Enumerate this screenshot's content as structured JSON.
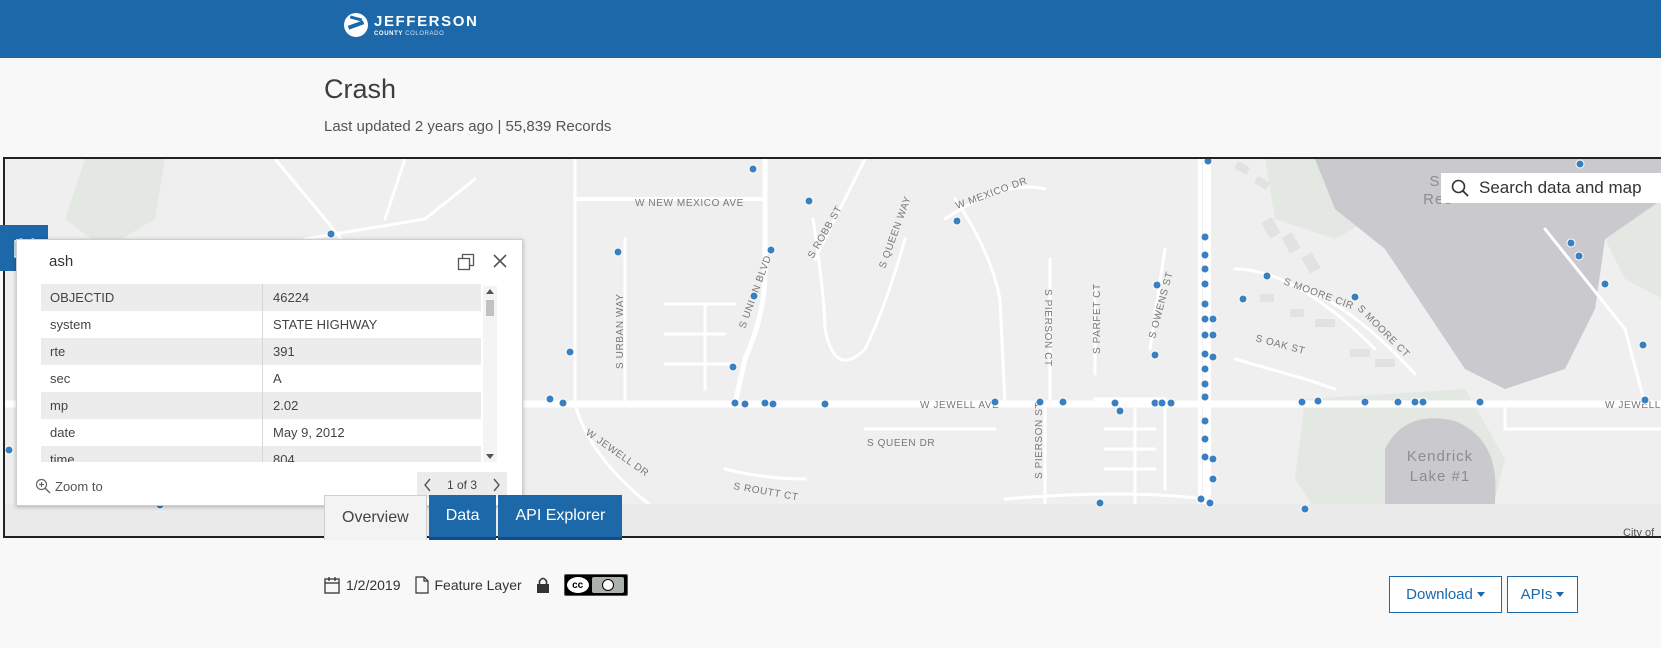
{
  "header": {
    "logo_title": "JEFFERSON",
    "logo_sub_county": "COUNTY",
    "logo_sub_state": "COLORADO"
  },
  "page": {
    "title": "Crash",
    "meta": "Last updated 2 years ago | 55,839 Records"
  },
  "map": {
    "search_placeholder": "Search data and map",
    "attribution": "City of",
    "streets": {
      "new_mexico_ave": "W NEW MEXICO AVE",
      "mexico_dr": "W MEXICO DR",
      "jewell_ave_1": "W JEWELL AVE",
      "jewell_ave_2": "W JEWELL",
      "jewell_dr": "W JEWELL DR",
      "queen_dr": "S QUEEN DR",
      "routt_ct": "S ROUTT CT",
      "urban_way": "S URBAN WAY",
      "union_blvd": "S UNION BLVD",
      "robb_st": "S ROBB ST",
      "queen_way": "S QUEEN WAY",
      "pierson_ct": "S PIERSON CT",
      "parfet_ct": "S PARFET CT",
      "owens_st": "S OWENS ST",
      "pierson_st": "S PIERSON ST",
      "moore_cir": "S MOORE CIR",
      "moore_ct": "S MOORE CT",
      "oak_st": "S OAK ST",
      "lake_label_1": "Kendrick",
      "lake_label_2": "Lake #1",
      "res_1": "S",
      "res_2": "Res"
    },
    "point_color": "#3a7fc1"
  },
  "popup": {
    "title": "ash",
    "rows": [
      {
        "key": "OBJECTID",
        "value": "46224"
      },
      {
        "key": "system",
        "value": "STATE HIGHWAY"
      },
      {
        "key": "rte",
        "value": "391"
      },
      {
        "key": "sec",
        "value": "A"
      },
      {
        "key": "mp",
        "value": "2.02"
      },
      {
        "key": "date",
        "value": "May 9, 2012"
      },
      {
        "key": "time",
        "value": "804"
      }
    ],
    "zoom_to": "Zoom to",
    "pager": "1 of 3"
  },
  "tabs": [
    {
      "label": "Overview"
    },
    {
      "label": "Data"
    },
    {
      "label": "API Explorer"
    }
  ],
  "details": {
    "date": "1/2/2019",
    "type": "Feature Layer",
    "license": "cc by"
  },
  "actions": {
    "download": "Download",
    "apis": "APIs"
  },
  "colors": {
    "brand": "#1d68a8",
    "map_bg": "#efefef"
  }
}
